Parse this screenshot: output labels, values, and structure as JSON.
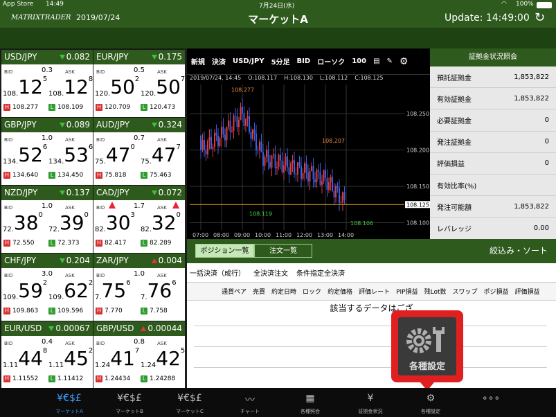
{
  "statusbar": {
    "carrier": "App Store",
    "time": "14:49",
    "date": "7月24日(水)",
    "battery": "100%"
  },
  "header": {
    "logo": "MATRIXTRADER",
    "date": "2019/07/24",
    "title": "マーケットA",
    "update": "Update: 14:49:00"
  },
  "tiles": [
    {
      "pair": "USD/JPY",
      "dir": "down",
      "change": "0.082",
      "spread": "0.3",
      "bid_pre": "108.",
      "bid_big": "12",
      "bid_sup": "5",
      "ask_pre": "108.",
      "ask_big": "12",
      "ask_sup": "8",
      "high": "108.277",
      "low": "108.109"
    },
    {
      "pair": "EUR/JPY",
      "dir": "down",
      "change": "0.175",
      "spread": "0.5",
      "bid_pre": "120.",
      "bid_big": "50",
      "bid_sup": "2",
      "ask_pre": "120.",
      "ask_big": "50",
      "ask_sup": "7",
      "high": "120.709",
      "low": "120.473"
    },
    {
      "pair": "GBP/JPY",
      "dir": "down",
      "change": "0.089",
      "spread": "1.0",
      "bid_pre": "134.",
      "bid_big": "52",
      "bid_sup": "6",
      "ask_pre": "134.",
      "ask_big": "53",
      "ask_sup": "6",
      "high": "134.640",
      "low": "134.450"
    },
    {
      "pair": "AUD/JPY",
      "dir": "down",
      "change": "0.324",
      "spread": "0.7",
      "bid_pre": "75.",
      "bid_big": "47",
      "bid_sup": "0",
      "ask_pre": "75.",
      "ask_big": "47",
      "ask_sup": "7",
      "high": "75.818",
      "low": "75.463"
    },
    {
      "pair": "NZD/JPY",
      "dir": "down",
      "change": "0.137",
      "spread": "1.0",
      "bid_pre": "72.",
      "bid_big": "38",
      "bid_sup": "0",
      "ask_pre": "72.",
      "ask_big": "39",
      "ask_sup": "0",
      "high": "72.550",
      "low": "72.373"
    },
    {
      "pair": "CAD/JPY",
      "dir": "down",
      "change": "0.072",
      "spread": "1.7",
      "bid_pre": "82.",
      "bid_big": "30",
      "bid_sup": "3",
      "ask_pre": "82.",
      "ask_big": "32",
      "ask_sup": "0",
      "high": "82.417",
      "low": "82.289",
      "arrows": true
    },
    {
      "pair": "CHF/JPY",
      "dir": "down",
      "change": "0.204",
      "spread": "3.0",
      "bid_pre": "109.",
      "bid_big": "59",
      "bid_sup": "2",
      "ask_pre": "109.",
      "ask_big": "62",
      "ask_sup": "2",
      "high": "109.863",
      "low": "109.596"
    },
    {
      "pair": "ZAR/JPY",
      "dir": "up",
      "change": "0.004",
      "spread": "1.0",
      "bid_pre": "7.",
      "bid_big": "75",
      "bid_sup": "6",
      "ask_pre": "7.",
      "ask_big": "76",
      "ask_sup": "6",
      "high": "7.770",
      "low": "7.758"
    },
    {
      "pair": "EUR/USD",
      "dir": "down",
      "change": "0.00067",
      "spread": "0.4",
      "bid_pre": "1.11",
      "bid_big": "44",
      "bid_sup": "8",
      "ask_pre": "1.11",
      "ask_big": "45",
      "ask_sup": "2",
      "high": "1.11552",
      "low": "1.11412"
    },
    {
      "pair": "GBP/USD",
      "dir": "up",
      "change": "0.00044",
      "spread": "0.8",
      "bid_pre": "1.24",
      "bid_big": "41",
      "bid_sup": "7",
      "ask_pre": "1.24",
      "ask_big": "42",
      "ask_sup": "5",
      "high": "1.24434",
      "low": "1.24288"
    }
  ],
  "labels": {
    "bid": "BID",
    "ask": "ASK",
    "h": "H",
    "l": "L"
  },
  "chart": {
    "toolbar": [
      "新規",
      "決済",
      "USD/JPY",
      "5分足",
      "BID",
      "ローソク",
      "100"
    ],
    "info": [
      "2019/07/24, 14:45",
      "O:108.117",
      "H:108.130",
      "L:108.112",
      "C:108.125"
    ],
    "yticks": [
      "108.250",
      "108.200",
      "108.150",
      "108.125",
      "108.100"
    ],
    "xticks": [
      "07:00",
      "08:00",
      "09:00",
      "10:00",
      "11:00",
      "12:00",
      "13:00",
      "14:00"
    ],
    "annotations": [
      "108.277",
      "108.207",
      "108.119",
      "108.106"
    ]
  },
  "chart_data": {
    "type": "candlestick",
    "series_name": "USD/JPY 5分足 BID",
    "ylim": [
      108.09,
      108.29
    ],
    "x": [
      "07:00",
      "08:00",
      "09:00",
      "10:00",
      "11:00",
      "12:00",
      "13:00",
      "14:00"
    ],
    "close": [
      108.2,
      108.22,
      108.25,
      108.19,
      108.18,
      108.17,
      108.16,
      108.125
    ]
  },
  "margin": {
    "title": "証拠金状況照会",
    "rows": [
      {
        "k": "預託証拠金",
        "v": "1,853,822"
      },
      {
        "k": "有効証拠金",
        "v": "1,853,822"
      },
      {
        "k": "必要証拠金",
        "v": "0"
      },
      {
        "k": "発注証拠金",
        "v": "0"
      },
      {
        "k": "評価損益",
        "v": "0"
      },
      {
        "k": "有効比率(%)",
        "v": ""
      },
      {
        "k": "発注可能額",
        "v": "1,853,822"
      },
      {
        "k": "レバレッジ",
        "v": "0.00"
      }
    ]
  },
  "positions": {
    "tab1": "ポジション一覧",
    "tab2": "注文一覧",
    "filter": "絞込み・ソート",
    "actions": [
      "一括決済（成行）",
      "全決済注文",
      "条件指定全決済"
    ],
    "cols": [
      "通貨ペア",
      "売買",
      "約定日時",
      "ロック",
      "約定価格",
      "評価レート",
      "PIP損益",
      "残Lot数",
      "スワップ",
      "ポジ損益",
      "評価損益"
    ],
    "empty": "該当するデータはござ"
  },
  "callout": {
    "label": "各種設定"
  },
  "tabs": [
    {
      "icon": "¥€$£",
      "label": "マーケットA",
      "active": true
    },
    {
      "icon": "¥€$£",
      "label": "マーケットB"
    },
    {
      "icon": "¥€$£",
      "label": "マーケットC"
    },
    {
      "icon": "〰",
      "label": "チャート"
    },
    {
      "icon": "▦",
      "label": "各種照会"
    },
    {
      "icon": "¥",
      "label": "証拠金状況"
    },
    {
      "icon": "⚙",
      "label": "各種設定"
    },
    {
      "icon": "∘∘∘",
      "label": ""
    }
  ]
}
